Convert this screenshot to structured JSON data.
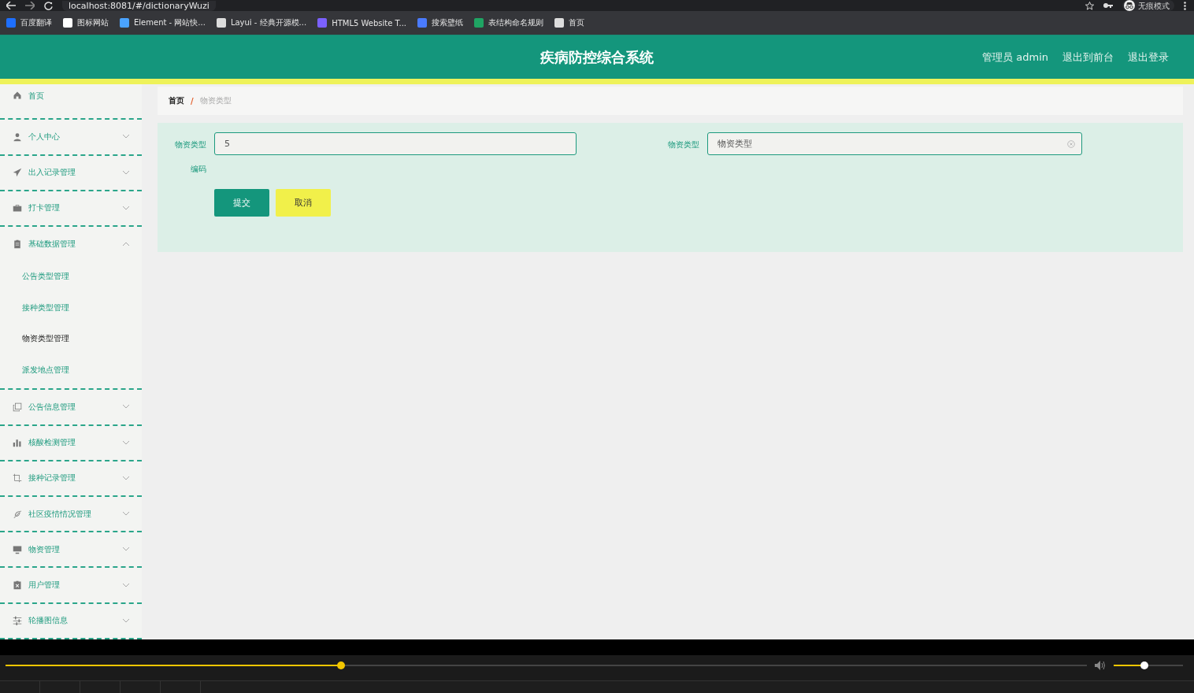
{
  "browser": {
    "address": "localhost:8081/#/dictionaryWuzi",
    "profile": "无痕模式",
    "bookmarks": [
      "百度翻译",
      "图标网站",
      "Element - 网站快...",
      "Layui - 经典开源模...",
      "HTML5 Website T...",
      "搜索壁纸",
      "表结构命名规则",
      "首页"
    ]
  },
  "header": {
    "title": "疾病防控综合系统",
    "links": [
      "管理员 admin",
      "退出到前台",
      "退出登录"
    ]
  },
  "sidebar": {
    "items": [
      {
        "label": "首页",
        "kind": "link"
      },
      {
        "label": "个人中心",
        "kind": "group",
        "expanded": false
      },
      {
        "label": "出入记录管理",
        "kind": "group",
        "expanded": false
      },
      {
        "label": "打卡管理",
        "kind": "group",
        "expanded": false
      },
      {
        "label": "基础数据管理",
        "kind": "group",
        "expanded": true,
        "children": [
          {
            "label": "公告类型管理",
            "selected": false
          },
          {
            "label": "接种类型管理",
            "selected": false
          },
          {
            "label": "物资类型管理",
            "selected": true
          },
          {
            "label": "派发地点管理",
            "selected": false
          }
        ]
      },
      {
        "label": "公告信息管理",
        "kind": "group",
        "expanded": false
      },
      {
        "label": "核酸检测管理",
        "kind": "group",
        "expanded": false
      },
      {
        "label": "接种记录管理",
        "kind": "group",
        "expanded": false
      },
      {
        "label": "社区疫情情况管理",
        "kind": "group",
        "expanded": false
      },
      {
        "label": "物资管理",
        "kind": "group",
        "expanded": false
      },
      {
        "label": "用户管理",
        "kind": "group",
        "expanded": false
      },
      {
        "label": "轮播图信息",
        "kind": "group",
        "expanded": false
      }
    ]
  },
  "breadcrumb": {
    "items": [
      "首页",
      "物资类型"
    ],
    "separator": "/"
  },
  "form": {
    "fields": [
      {
        "label": "物资类型编码",
        "value": "5",
        "clearable": false
      },
      {
        "label": "物资类型",
        "value": "物资类型",
        "clearable": true
      }
    ],
    "buttons": [
      {
        "label": "提交",
        "kind": "primary"
      },
      {
        "label": "取消",
        "kind": "secondary"
      }
    ]
  },
  "player": {
    "progress": {
      "level": 0.31
    },
    "volume": {
      "level": 0.44
    }
  }
}
